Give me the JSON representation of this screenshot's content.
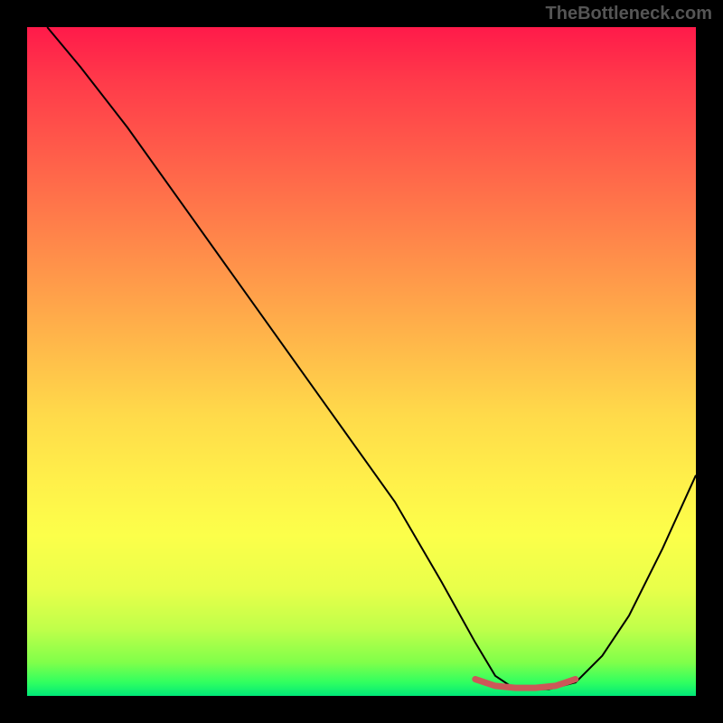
{
  "watermark": "TheBottleneck.com",
  "chart_data": {
    "type": "line",
    "title": "",
    "xlabel": "",
    "ylabel": "",
    "xlim": [
      0,
      100
    ],
    "ylim": [
      0,
      100
    ],
    "series": [
      {
        "name": "curve",
        "color": "#000000",
        "x": [
          3,
          8,
          15,
          25,
          35,
          45,
          55,
          62,
          67,
          70,
          73,
          78,
          82,
          86,
          90,
          95,
          100
        ],
        "y": [
          100,
          94,
          85,
          71,
          57,
          43,
          29,
          17,
          8,
          3,
          1,
          1,
          2,
          6,
          12,
          22,
          33
        ]
      },
      {
        "name": "highlight",
        "color": "#d66060",
        "x": [
          67,
          70,
          73,
          76,
          79,
          82
        ],
        "y": [
          2.5,
          1.5,
          1.2,
          1.2,
          1.5,
          2.5
        ]
      }
    ],
    "gradient_stops": [
      {
        "pos": 0,
        "color": "#ff1a4a"
      },
      {
        "pos": 50,
        "color": "#ffca4a"
      },
      {
        "pos": 85,
        "color": "#f0ff4a"
      },
      {
        "pos": 100,
        "color": "#00e878"
      }
    ]
  }
}
